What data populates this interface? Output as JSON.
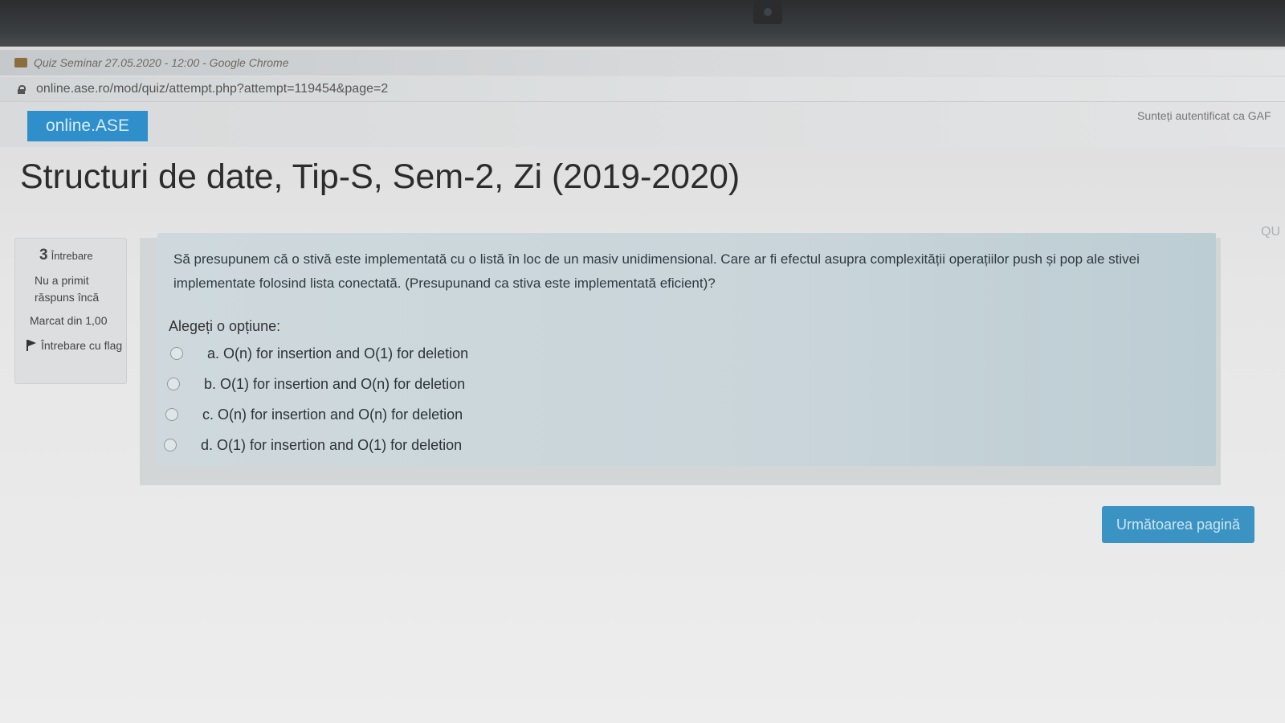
{
  "browser": {
    "window_title": "Quiz Seminar 27.05.2020 - 12:00 - Google Chrome",
    "url": "online.ase.ro/mod/quiz/attempt.php?attempt=119454&page=2"
  },
  "navbar": {
    "brand": "online.ASE",
    "login_info": "Sunteți autentificat ca GAF"
  },
  "course_title": "Structuri de date, Tip-S, Sem-2, Zi (2019-2020)",
  "side_text": "QU",
  "question_info": {
    "number": "3",
    "number_label": "Întrebare",
    "state": "Nu a primit răspuns încă",
    "grade": "Marcat din 1,00",
    "flag_label": "Întrebare cu flag"
  },
  "question": {
    "text": "Să presupunem că o stivă este implementată cu o listă în loc de un masiv unidimensional. Care ar fi efectul asupra complexității operațiilor push și pop ale stivei implementate folosind lista conectată. (Presupunand ca stiva este implementată eficient)?",
    "prompt": "Alegeți o opțiune:",
    "answers": [
      {
        "label": "a. O(n) for insertion and O(1) for deletion",
        "selected": false
      },
      {
        "label": "b. O(1) for insertion and O(n) for deletion",
        "selected": false
      },
      {
        "label": "c. O(n) for insertion and O(n) for deletion",
        "selected": false
      },
      {
        "label": "d. O(1) for insertion and O(1) for deletion",
        "selected": false
      }
    ]
  },
  "next_button": "Următoarea pagină"
}
